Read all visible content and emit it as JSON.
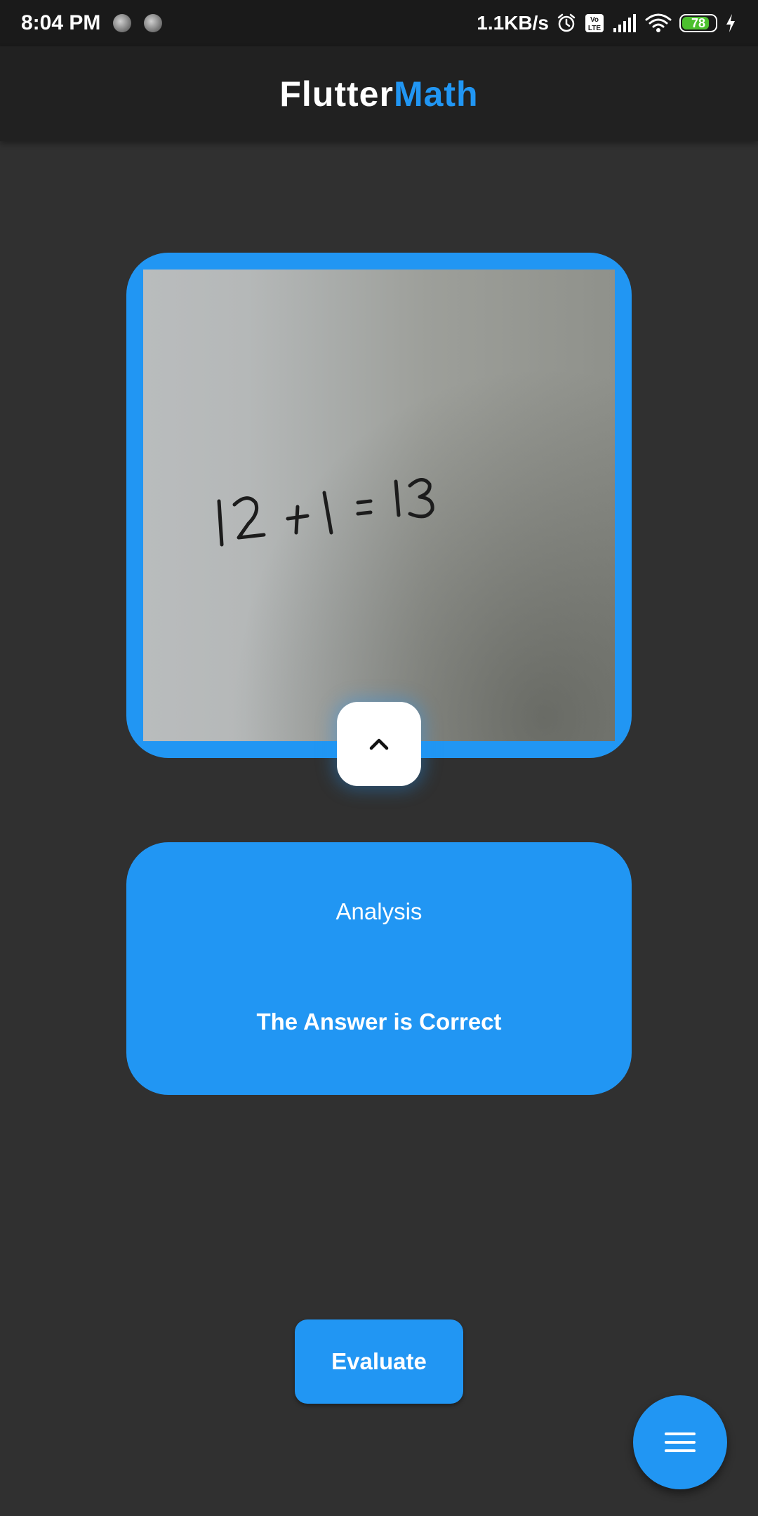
{
  "status_bar": {
    "time": "8:04 PM",
    "net_speed": "1.1KB/s",
    "volte": "Vo LTE",
    "battery_level": "78",
    "battery_color": "#4cc02e"
  },
  "app_bar": {
    "title_part1": "Flutter",
    "title_part2": "Math",
    "accent_color": "#2196f3"
  },
  "image_card": {
    "handwritten_text": "12 + 1 = 13",
    "expand_icon": "chevron-up-icon"
  },
  "analysis": {
    "title": "Analysis",
    "result": "The Answer is Correct"
  },
  "actions": {
    "evaluate_label": "Evaluate",
    "menu_icon": "menu-icon"
  }
}
